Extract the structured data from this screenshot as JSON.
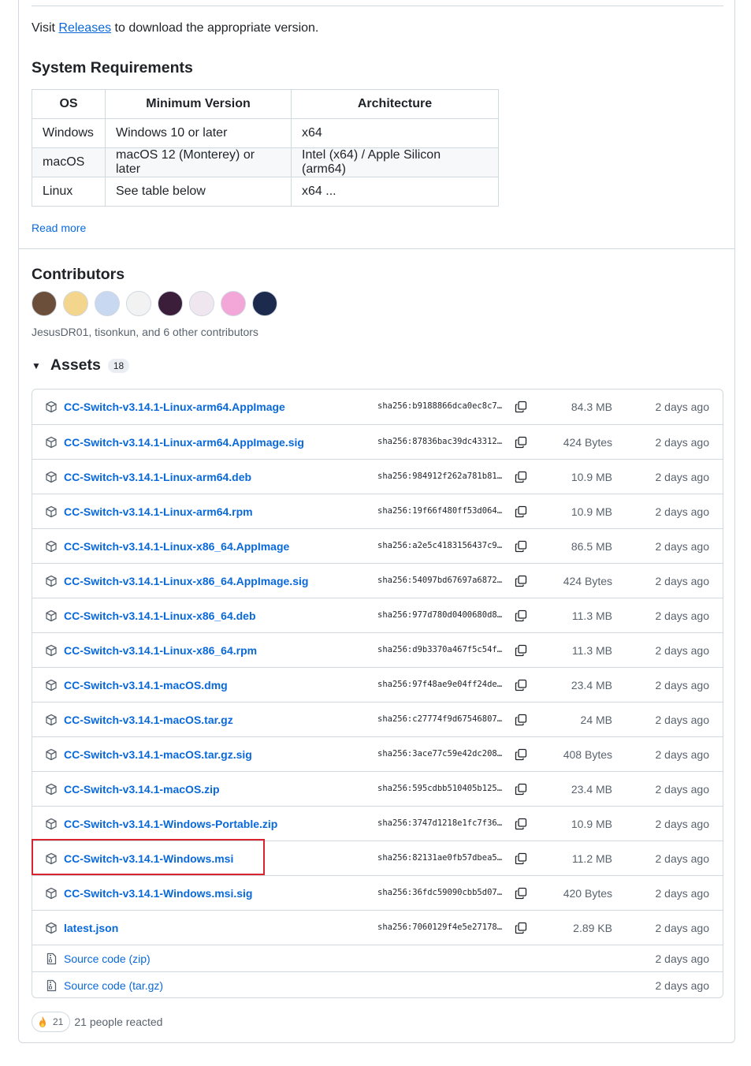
{
  "intro": {
    "prefix": "Visit ",
    "link": "Releases",
    "suffix": " to download the appropriate version."
  },
  "requirements": {
    "title": "System Requirements",
    "headers": [
      "OS",
      "Minimum Version",
      "Architecture"
    ],
    "rows": [
      [
        "Windows",
        "Windows 10 or later",
        "x64"
      ],
      [
        "macOS",
        "macOS 12 (Monterey) or later",
        "Intel (x64) / Apple Silicon (arm64)"
      ],
      [
        "Linux",
        "See table below",
        "x64 ..."
      ]
    ],
    "read_more": "Read more"
  },
  "contributors": {
    "title": "Contributors",
    "summary": "JesusDR01, tisonkun, and 6 other contributors",
    "avatars": [
      {
        "name": "avatar-1",
        "color": "#6b4f3a"
      },
      {
        "name": "avatar-2",
        "color": "#f4d58d"
      },
      {
        "name": "avatar-3",
        "color": "#c8d8f0"
      },
      {
        "name": "avatar-4",
        "color": "#f2f2f2"
      },
      {
        "name": "avatar-5",
        "color": "#3b1f3a"
      },
      {
        "name": "avatar-6",
        "color": "#efe6f0"
      },
      {
        "name": "avatar-7",
        "color": "#f3a6d8"
      },
      {
        "name": "avatar-8",
        "color": "#1c2b4d"
      }
    ]
  },
  "assets": {
    "title": "Assets",
    "count": "18",
    "items": [
      {
        "name": "CC-Switch-v3.14.1-Linux-arm64.AppImage",
        "sha": "sha256:b9188866dca0ec8c7…",
        "size": "84.3 MB",
        "date": "2 days ago"
      },
      {
        "name": "CC-Switch-v3.14.1-Linux-arm64.AppImage.sig",
        "sha": "sha256:87836bac39dc43312…",
        "size": "424 Bytes",
        "date": "2 days ago"
      },
      {
        "name": "CC-Switch-v3.14.1-Linux-arm64.deb",
        "sha": "sha256:984912f262a781b81…",
        "size": "10.9 MB",
        "date": "2 days ago"
      },
      {
        "name": "CC-Switch-v3.14.1-Linux-arm64.rpm",
        "sha": "sha256:19f66f480ff53d064…",
        "size": "10.9 MB",
        "date": "2 days ago"
      },
      {
        "name": "CC-Switch-v3.14.1-Linux-x86_64.AppImage",
        "sha": "sha256:a2e5c4183156437c9…",
        "size": "86.5 MB",
        "date": "2 days ago"
      },
      {
        "name": "CC-Switch-v3.14.1-Linux-x86_64.AppImage.sig",
        "sha": "sha256:54097bd67697a6872…",
        "size": "424 Bytes",
        "date": "2 days ago"
      },
      {
        "name": "CC-Switch-v3.14.1-Linux-x86_64.deb",
        "sha": "sha256:977d780d0400680d8…",
        "size": "11.3 MB",
        "date": "2 days ago"
      },
      {
        "name": "CC-Switch-v3.14.1-Linux-x86_64.rpm",
        "sha": "sha256:d9b3370a467f5c54f…",
        "size": "11.3 MB",
        "date": "2 days ago"
      },
      {
        "name": "CC-Switch-v3.14.1-macOS.dmg",
        "sha": "sha256:97f48ae9e04ff24de…",
        "size": "23.4 MB",
        "date": "2 days ago"
      },
      {
        "name": "CC-Switch-v3.14.1-macOS.tar.gz",
        "sha": "sha256:c27774f9d67546807…",
        "size": "24 MB",
        "date": "2 days ago"
      },
      {
        "name": "CC-Switch-v3.14.1-macOS.tar.gz.sig",
        "sha": "sha256:3ace77c59e42dc208…",
        "size": "408 Bytes",
        "date": "2 days ago"
      },
      {
        "name": "CC-Switch-v3.14.1-macOS.zip",
        "sha": "sha256:595cdbb510405b125…",
        "size": "23.4 MB",
        "date": "2 days ago"
      },
      {
        "name": "CC-Switch-v3.14.1-Windows-Portable.zip",
        "sha": "sha256:3747d1218e1fc7f36…",
        "size": "10.9 MB",
        "date": "2 days ago"
      },
      {
        "name": "CC-Switch-v3.14.1-Windows.msi",
        "sha": "sha256:82131ae0fb57dbea5…",
        "size": "11.2 MB",
        "date": "2 days ago"
      },
      {
        "name": "CC-Switch-v3.14.1-Windows.msi.sig",
        "sha": "sha256:36fdc59090cbb5d07…",
        "size": "420 Bytes",
        "date": "2 days ago"
      },
      {
        "name": "latest.json",
        "sha": "sha256:7060129f4e5e27178…",
        "size": "2.89 KB",
        "date": "2 days ago"
      }
    ],
    "source": [
      {
        "label": "Source code",
        "suffix": " (zip)",
        "date": "2 days ago"
      },
      {
        "label": "Source code",
        "suffix": " (tar.gz)",
        "date": "2 days ago"
      }
    ]
  },
  "reactions": {
    "count": "21",
    "text": "21 people reacted"
  },
  "colors": {
    "link": "#0969da",
    "highlight": "#d9232f",
    "border": "#d1d9e0"
  }
}
